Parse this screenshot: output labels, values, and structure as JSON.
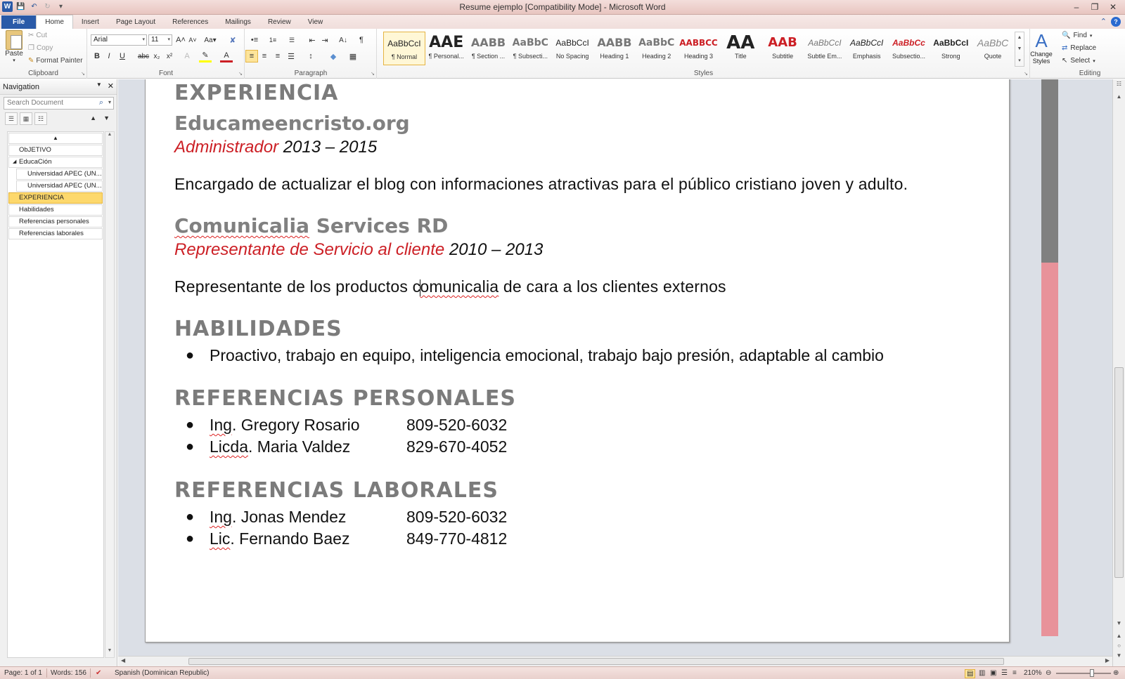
{
  "window": {
    "title": "Resume ejemplo [Compatibility Mode]  -  Microsoft Word"
  },
  "ribbon_tabs": [
    "File",
    "Home",
    "Insert",
    "Page Layout",
    "References",
    "Mailings",
    "Review",
    "View"
  ],
  "clipboard": {
    "paste": "Paste",
    "cut": "Cut",
    "copy": "Copy",
    "format_painter": "Format Painter",
    "label": "Clipboard"
  },
  "font": {
    "name": "Arial",
    "size": "11",
    "label": "Font"
  },
  "paragraph": {
    "label": "Paragraph"
  },
  "styles": {
    "label": "Styles",
    "items": [
      {
        "sample": "AaBbCcI",
        "name": "¶ Normal",
        "selected": true
      },
      {
        "sample": "AAE",
        "name": "¶ Personal..."
      },
      {
        "sample": "AABB",
        "name": "¶ Section ..."
      },
      {
        "sample": "AaBbC",
        "name": "¶ Subsecti..."
      },
      {
        "sample": "AaBbCcI",
        "name": "No Spacing"
      },
      {
        "sample": "AABB",
        "name": "Heading 1"
      },
      {
        "sample": "AaBbC",
        "name": "Heading 2"
      },
      {
        "sample": "AABBCC",
        "name": "Heading 3"
      },
      {
        "sample": "AA",
        "name": "Title"
      },
      {
        "sample": "AAB",
        "name": "Subtitle"
      },
      {
        "sample": "AaBbCcI",
        "name": "Subtle Em..."
      },
      {
        "sample": "AaBbCcI",
        "name": "Emphasis"
      },
      {
        "sample": "AaBbCc",
        "name": "Subsectio..."
      },
      {
        "sample": "AaBbCcI",
        "name": "Strong"
      },
      {
        "sample": "AaBbC",
        "name": "Quote"
      }
    ],
    "change_styles": "Change Styles"
  },
  "editing": {
    "find": "Find",
    "replace": "Replace",
    "select": "Select",
    "label": "Editing"
  },
  "navigation": {
    "title": "Navigation",
    "search_placeholder": "Search Document",
    "items": [
      {
        "label": "ObJETIVO",
        "level": 1
      },
      {
        "label": "EducaCión",
        "level": 1,
        "expanded": true
      },
      {
        "label": "Universidad APEC (UN...",
        "level": 2
      },
      {
        "label": "Universidad APEC (UN...",
        "level": 2
      },
      {
        "label": "EXPERIENCIA",
        "level": 1,
        "active": true
      },
      {
        "label": "Habilidades",
        "level": 1
      },
      {
        "label": "Referencias personales",
        "level": 1
      },
      {
        "label": "Referencias laborales",
        "level": 1
      }
    ]
  },
  "document": {
    "experiencia_heading": "EXPERIENCIA",
    "job1": {
      "company": "Educameencristo.org",
      "role": "Administrador",
      "years": " 2013 – 2015",
      "description": "Encargado de actualizar el blog con informaciones atractivas para el público cristiano joven y adulto."
    },
    "job2": {
      "company_part1": "Comunicalia",
      "company_part2": " Services RD",
      "role": "Representante de Servicio al cliente",
      "years": " 2010 – 2013",
      "description_pre": "Representante de los productos c",
      "description_sq": "omunicalia",
      "description_post": " de cara a los clientes externos"
    },
    "habilidades_heading": "HABILIDADES",
    "habilidades": "Proactivo, trabajo en equipo, inteligencia emocional, trabajo bajo presión, adaptable al cambio",
    "ref_personales_heading": "REFERENCIAS PERSONALES",
    "ref_personales": [
      {
        "title": "Ing",
        "name": ". Gregory Rosario",
        "phone": "809-520-6032"
      },
      {
        "title": "Licda",
        "name": ". Maria Valdez",
        "phone": "829-670-4052"
      }
    ],
    "ref_laborales_heading": "REFERENCIAS LABORALES",
    "ref_laborales": [
      {
        "title": "Ing",
        "name": ". Jonas Mendez",
        "phone": "809-520-6032"
      },
      {
        "title": "Lic",
        "name": ". Fernando Baez",
        "phone": "849-770-4812"
      }
    ]
  },
  "status": {
    "page": "Page: 1 of 1",
    "words": "Words: 156",
    "language": "Spanish (Dominican Republic)",
    "zoom": "210%"
  },
  "colors": {
    "accent_red": "#cc1f25",
    "heading_gray": "#7b7b7b",
    "band_pink": "#e8929a",
    "band_gray": "#808080"
  }
}
